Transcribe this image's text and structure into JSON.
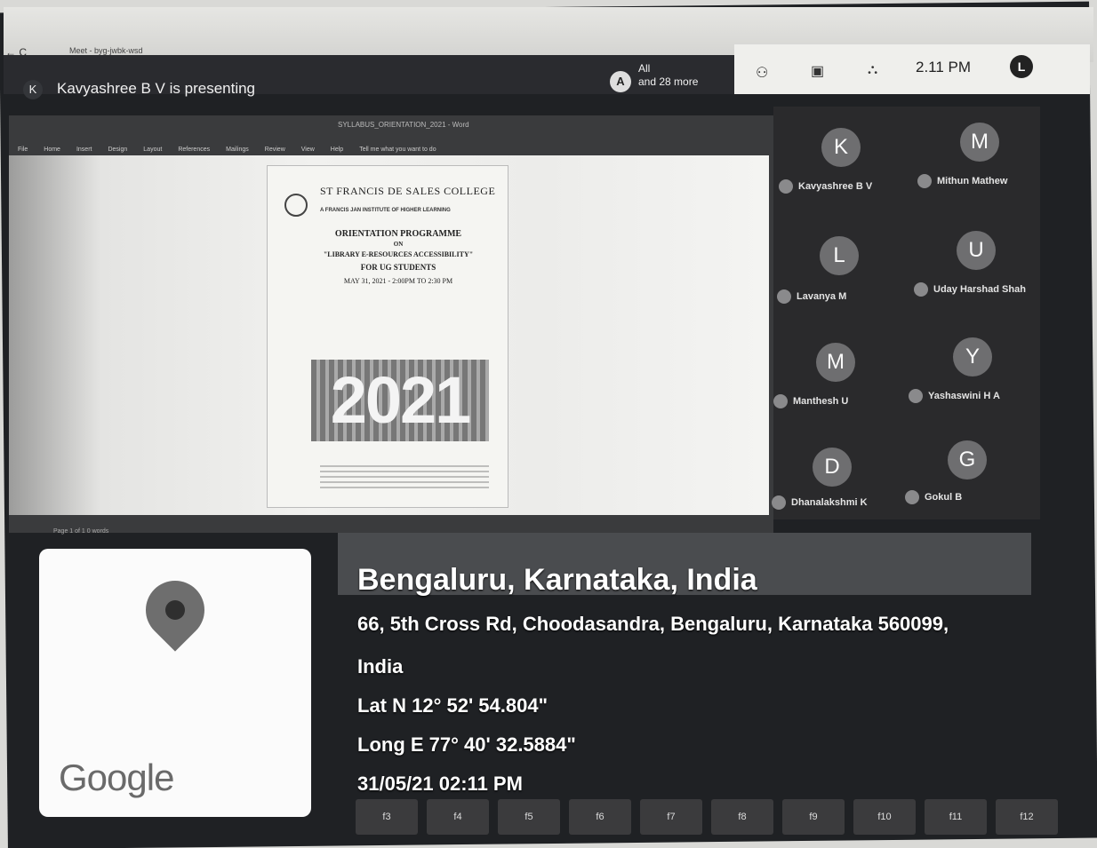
{
  "browser": {
    "back_icon": "arrow-left-icon",
    "reload_icon": "reload-icon",
    "url": "Meet - byg-jwbk-wsd"
  },
  "meet": {
    "presenter_initial": "K",
    "presenting_label": "Kavyashree B V is presenting",
    "people_initial": "A",
    "people_summary_line1": "All",
    "people_summary_line2": "and 28 more",
    "time": "2.11 PM",
    "user_initial": "L"
  },
  "word": {
    "title": "SYLLABUS_ORIENTATION_2021 - Word",
    "menu": [
      "File",
      "Home",
      "Insert",
      "Design",
      "Layout",
      "References",
      "Mailings",
      "Review",
      "View",
      "Help"
    ],
    "tell_me": "Tell me what you want to do",
    "status": "Page 1 of 1  0 words"
  },
  "poster": {
    "college": "ST FRANCIS DE SALES COLLEGE",
    "subtitle": "A FRANCIS JAN INSTITUTE OF HIGHER LEARNING",
    "heading_lines": [
      "ORIENTATION PROGRAMME",
      "ON",
      "\"LIBRARY E-RESOURCES ACCESSIBILITY\"",
      "FOR UG STUDENTS",
      "MAY 31, 2021 - 2:00PM TO 2:30 PM"
    ],
    "year": "2021"
  },
  "participants": [
    {
      "initial": "K",
      "name": "Kavyashree B V"
    },
    {
      "initial": "M",
      "name": "Mithun Mathew"
    },
    {
      "initial": "L",
      "name": "Lavanya M"
    },
    {
      "initial": "U",
      "name": "Uday Harshad Shah"
    },
    {
      "initial": "M",
      "name": "Manthesh U"
    },
    {
      "initial": "Y",
      "name": "Yashaswini H A"
    },
    {
      "initial": "D",
      "name": "Dhanalakshmi K"
    },
    {
      "initial": "G",
      "name": "Gokul B"
    }
  ],
  "location": {
    "map_brand": "Google",
    "title": "Bengaluru, Karnataka, India",
    "address_line1": "66, 5th Cross Rd, Choodasandra, Bengaluru, Karnataka 560099,",
    "address_line2": "India",
    "latitude": "Lat N 12° 52' 54.804\"",
    "longitude": "Long E 77° 40' 32.5884\"",
    "datetime": "31/05/21 02:11 PM"
  },
  "keyboard_keys": [
    "f3",
    "f4",
    "f5",
    "f6",
    "f7",
    "f8",
    "f9",
    "f10",
    "f11",
    "f12"
  ],
  "colors": {
    "meet_dark": "#2a2b2f",
    "avatar_gray": "#6e6e70",
    "overlay_text": "#ffffff"
  }
}
